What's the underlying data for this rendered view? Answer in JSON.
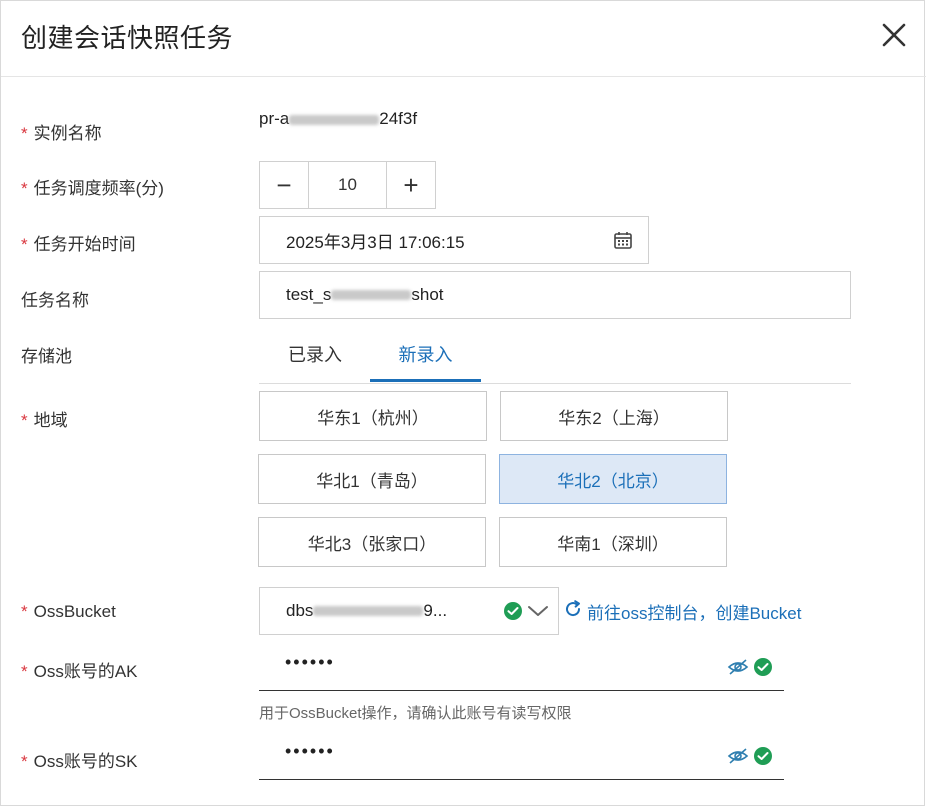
{
  "dialog": {
    "title": "创建会话快照任务"
  },
  "fields": {
    "instance_name": {
      "label": "实例名称",
      "value_prefix": "pr-a",
      "value_suffix": "24f3f"
    },
    "frequency": {
      "label": "任务调度频率(分)",
      "value": "10",
      "minus": "−",
      "plus": "+"
    },
    "start_time": {
      "label": "任务开始时间",
      "value": "2025年3月3日 17:06:15"
    },
    "task_name": {
      "label": "任务名称",
      "value_prefix": "test_s",
      "value_suffix": "shot"
    },
    "storage_pool": {
      "label": "存储池",
      "tabs": [
        {
          "label": "已录入"
        },
        {
          "label": "新录入"
        }
      ],
      "active_tab": "新录入"
    },
    "region": {
      "label": "地域",
      "options": [
        {
          "label": "华东1（杭州）"
        },
        {
          "label": "华东2（上海）"
        },
        {
          "label": "华北1（青岛）"
        },
        {
          "label": "华北2（北京）"
        },
        {
          "label": "华北3（张家口）"
        },
        {
          "label": "华南1（深圳）"
        }
      ],
      "selected": "华北2（北京）"
    },
    "oss_bucket": {
      "label": "OssBucket",
      "value_prefix": "dbs",
      "value_suffix": "9...",
      "link": "前往oss控制台，创建Bucket"
    },
    "oss_ak": {
      "label": "Oss账号的AK",
      "masked": "••••••",
      "hint": "用于OssBucket操作，请确认此账号有读写权限"
    },
    "oss_sk": {
      "label": "Oss账号的SK",
      "masked": "••••••"
    }
  },
  "colors": {
    "required": "#d9363e",
    "accent": "#1b6fb8",
    "success": "#1f9d55",
    "selected_bg": "#dde8f6"
  },
  "icons": [
    "close-icon",
    "minus-icon",
    "plus-icon",
    "calendar-icon",
    "check-circle-icon",
    "chevron-down-icon",
    "refresh-icon",
    "eye-off-icon"
  ]
}
